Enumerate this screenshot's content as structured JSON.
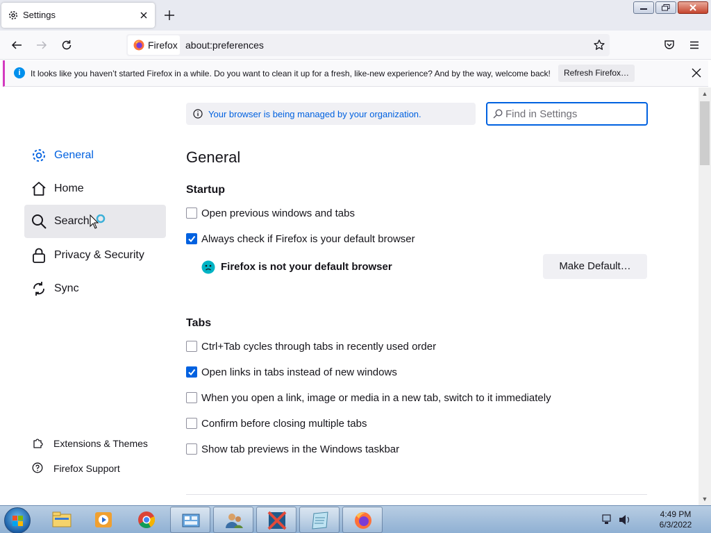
{
  "tab": {
    "title": "Settings"
  },
  "urlbar": {
    "identity_label": "Firefox",
    "url": "about:preferences"
  },
  "notification": {
    "message": "It looks like you haven’t started Firefox in a while. Do you want to clean it up for a fresh, like-new experience? And by the way, welcome back!",
    "button": "Refresh Firefox…"
  },
  "managed_notice": "Your browser is being managed by your organization.",
  "search": {
    "placeholder": "Find in Settings"
  },
  "sidebar": {
    "items": [
      {
        "label": "General",
        "icon": "gear-icon",
        "active": true
      },
      {
        "label": "Home",
        "icon": "home-icon"
      },
      {
        "label": "Search",
        "icon": "search-icon",
        "hover": true
      },
      {
        "label": "Privacy & Security",
        "icon": "lock-icon"
      },
      {
        "label": "Sync",
        "icon": "sync-icon"
      }
    ],
    "footer": [
      {
        "label": "Extensions & Themes",
        "icon": "puzzle-icon"
      },
      {
        "label": "Firefox Support",
        "icon": "help-icon"
      }
    ]
  },
  "main": {
    "heading": "General",
    "startup": {
      "heading": "Startup",
      "options": [
        {
          "label": "Open previous windows and tabs",
          "checked": false
        },
        {
          "label": "Always check if Firefox is your default browser",
          "checked": true
        }
      ],
      "not_default_text": "Firefox is not your default browser",
      "make_default_button": "Make Default…"
    },
    "tabs": {
      "heading": "Tabs",
      "options": [
        {
          "label": "Ctrl+Tab cycles through tabs in recently used order",
          "checked": false
        },
        {
          "label": "Open links in tabs instead of new windows",
          "checked": true
        },
        {
          "label": "When you open a link, image or media in a new tab, switch to it immediately",
          "checked": false
        },
        {
          "label": "Confirm before closing multiple tabs",
          "checked": false
        },
        {
          "label": "Show tab previews in the Windows taskbar",
          "checked": false
        }
      ]
    }
  },
  "taskbar": {
    "pinned": [
      "explorer-icon",
      "media-player-icon",
      "chrome-icon",
      "control-panel-icon",
      "users-icon",
      "app-icon",
      "notepad-icon",
      "firefox-icon"
    ],
    "clock_time": "4:49 PM",
    "clock_date": "6/3/2022"
  },
  "colors": {
    "accent": "#0061e0",
    "notif_border": "#d33ac0",
    "hover_bg": "#e8e8ec"
  }
}
